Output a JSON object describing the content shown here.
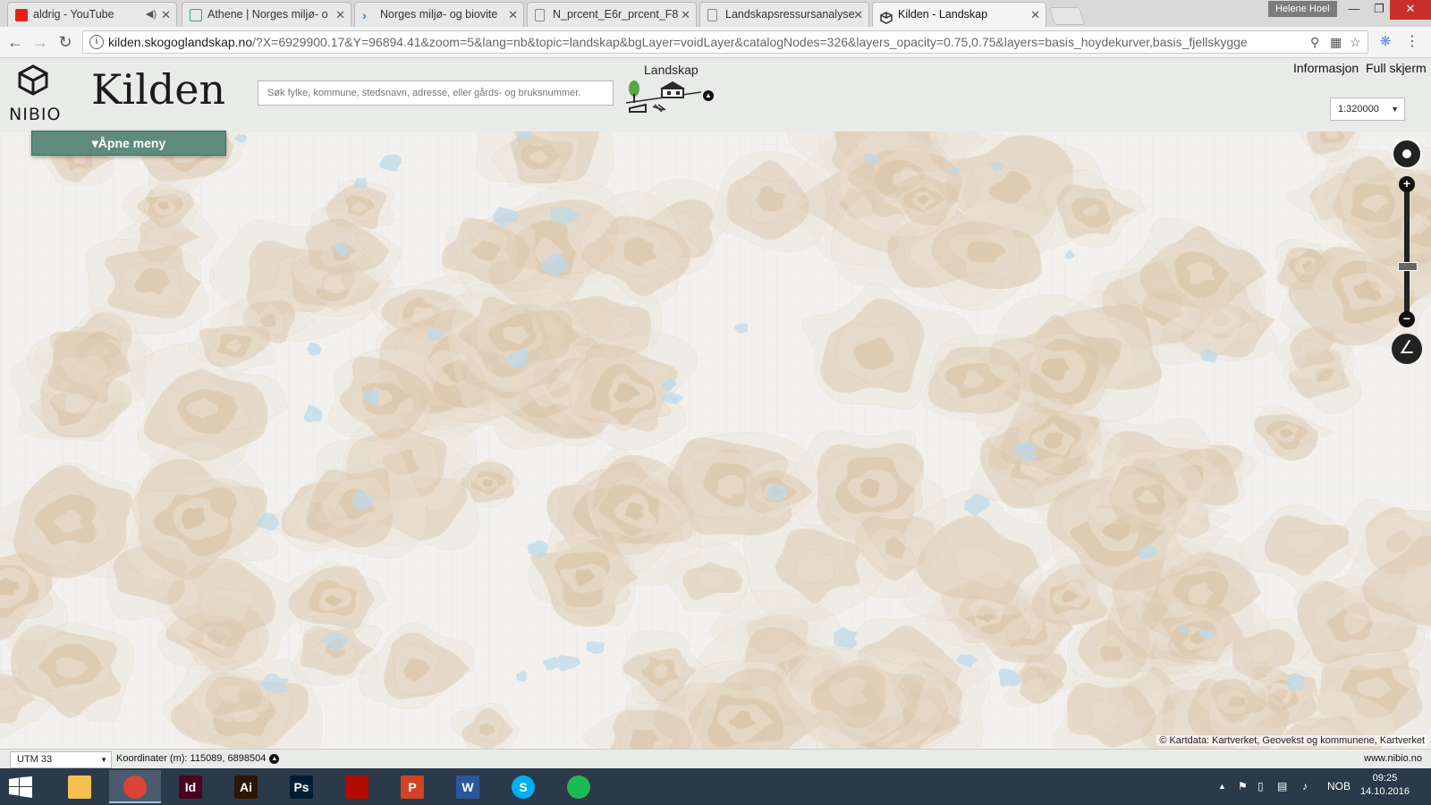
{
  "browser": {
    "tabs": [
      {
        "title": "aldrig - YouTube",
        "icon": "youtube-icon",
        "color": "#e62117",
        "muted": true
      },
      {
        "title": "Athene | Norges miljø- o",
        "icon": "page-icon",
        "color": "#4a9a6e"
      },
      {
        "title": "Norges miljø- og biovite",
        "icon": "arrow-icon",
        "color": "#3a7bd5"
      },
      {
        "title": "N_prcent_E6r_prcent_F8",
        "icon": "document-icon",
        "color": "#777777"
      },
      {
        "title": "Landskapsressursanalyse",
        "icon": "document-icon",
        "color": "#777777"
      },
      {
        "title": "Kilden - Landskap",
        "icon": "nibio-icon",
        "color": "#333333",
        "active": true
      }
    ],
    "user": "Helene Hoel",
    "url_host": "kilden.skogoglandskap.no",
    "url_rest": "/?X=6929900.17&Y=96894.41&zoom=5&lang=nb&topic=landskap&bgLayer=voidLayer&catalogNodes=326&layers_opacity=0.75,0.75&layers=basis_hoydekurver,basis_fjellskygge"
  },
  "app": {
    "logo_text": "NIBIO",
    "title": "Kilden",
    "search_placeholder": "Søk fylke, kommune, stedsnavn, adresse, eller gårds- og bruksnummer.",
    "topic_label": "Landskap",
    "links": {
      "info": "Informasjon",
      "fullscreen": "Full skjerm"
    },
    "scale": "1:320000",
    "menu_label": "Åpne meny"
  },
  "map": {
    "attribution": "© Kartdata: Kartverket, Geovekst og kommunene, Kartverket",
    "projection": "UTM 33",
    "coordinates_label": "Koordinater (m): 115089, 6898504",
    "site": "www.nibio.no",
    "colors": {
      "snow": "#f2f1ee",
      "relief": "#d9c4a8",
      "glacier": "#bcd9ea",
      "contour": "#e3cdb4"
    }
  },
  "taskbar": {
    "apps": [
      {
        "name": "file-explorer",
        "label": "",
        "color": "#f2c14e"
      },
      {
        "name": "chrome",
        "label": "",
        "color": "#db4437",
        "active": true
      },
      {
        "name": "indesign",
        "label": "Id",
        "color": "#49021f"
      },
      {
        "name": "illustrator",
        "label": "Ai",
        "color": "#2d1600"
      },
      {
        "name": "photoshop",
        "label": "Ps",
        "color": "#001d34"
      },
      {
        "name": "acrobat",
        "label": "",
        "color": "#b30b00"
      },
      {
        "name": "powerpoint",
        "label": "P",
        "color": "#d04423"
      },
      {
        "name": "word",
        "label": "W",
        "color": "#2b579a"
      },
      {
        "name": "skype",
        "label": "S",
        "color": "#00aff0"
      },
      {
        "name": "spotify",
        "label": "",
        "color": "#1db954"
      }
    ],
    "language": "NOB",
    "time": "09:25",
    "date": "14.10.2016"
  }
}
